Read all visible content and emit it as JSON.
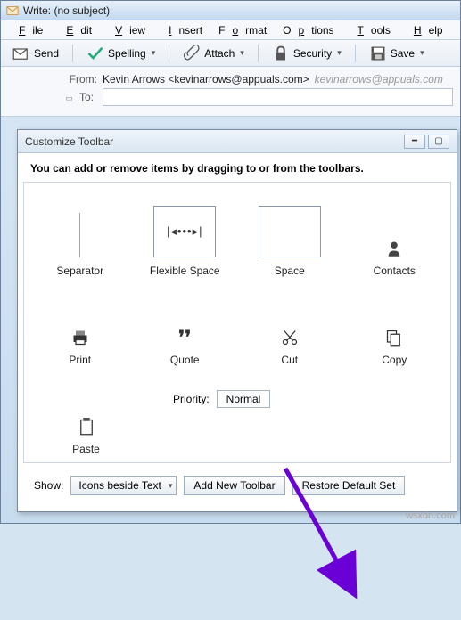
{
  "window": {
    "title": "Write: (no subject)"
  },
  "menubar": [
    "File",
    "Edit",
    "View",
    "Insert",
    "Format",
    "Options",
    "Tools",
    "Help"
  ],
  "toolbar": {
    "send": "Send",
    "spelling": "Spelling",
    "attach": "Attach",
    "security": "Security",
    "save": "Save"
  },
  "fields": {
    "from_label": "From:",
    "from_value": "Kevin Arrows <kevinarrows@appuals.com>",
    "from_secondary": "kevinarrows@appuals.com",
    "to_label": "To:"
  },
  "dialog": {
    "title": "Customize Toolbar",
    "instruction": "You can add or remove items by dragging to or from the toolbars.",
    "items_row1": [
      "Separator",
      "Flexible Space",
      "Space",
      "Contacts"
    ],
    "items_row2": [
      "Print",
      "Quote",
      "Cut",
      "Copy"
    ],
    "paste_label": "Paste",
    "priority_label": "Priority:",
    "priority_value": "Normal",
    "show_label": "Show:",
    "show_value": "Icons beside Text",
    "add_toolbar": "Add New Toolbar",
    "restore": "Restore Default Set"
  },
  "watermark": "wsxdn.com"
}
